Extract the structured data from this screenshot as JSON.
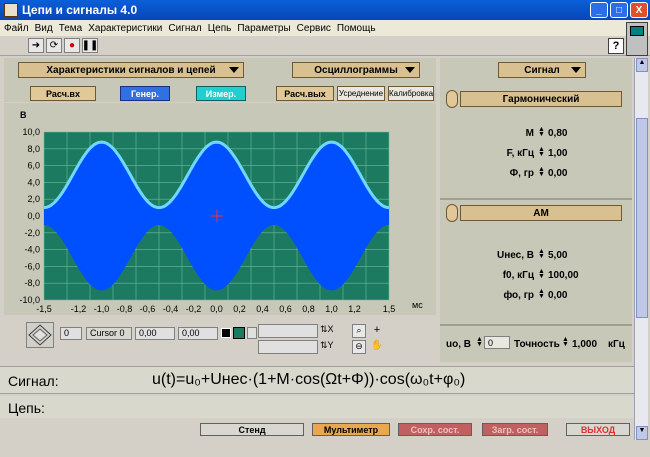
{
  "window": {
    "title": "Цепи и сигналы 4.0",
    "min": "_",
    "max": "□",
    "close": "X"
  },
  "menu": [
    "Файл",
    "Вид",
    "Тема",
    "Характеристики",
    "Сигнал",
    "Цепь",
    "Параметры",
    "Сервис",
    "Помощь"
  ],
  "toolbar": {
    "help": "?"
  },
  "left_dropdown": "Характеристики сигналов и цепей",
  "mid_dropdown": "Осциллограммы",
  "tabs": {
    "calc_in": "Расч.вх",
    "gen": "Генер.",
    "meas": "Измер.",
    "calc_out": "Расч.вых",
    "avg": "Усреднение",
    "calib": "Калибровка"
  },
  "graph": {
    "ylabel": "В",
    "xlabel": "мс",
    "yticks": [
      "10,0",
      "8,0",
      "6,0",
      "4,0",
      "2,0",
      "0,0",
      "-2,0",
      "-4,0",
      "-6,0",
      "-8,0",
      "-10,0"
    ],
    "xticks": [
      "-1,5",
      "-1,2",
      "-1,0",
      "-0,8",
      "-0,6",
      "-0,4",
      "-0,2",
      "0,0",
      "0,2",
      "0,4",
      "0,6",
      "0,8",
      "1,0",
      "1,2",
      "1,5"
    ],
    "colors": {
      "plot_bg": "#1c7a60",
      "grid": "#6fb89e",
      "envelope": "#0050ff",
      "edge": "#70d8ff",
      "cursor": "#ff3030"
    }
  },
  "chart_data": {
    "type": "line",
    "ylabel": "В",
    "xlabel": "мс",
    "xlim": [
      -1.5,
      1.5
    ],
    "ylim": [
      -10,
      10
    ],
    "grid": true,
    "series": [
      {
        "x": [
          -1.5,
          -1.0,
          -0.5,
          0.0,
          0.5,
          1.0,
          1.5
        ],
        "y": [
          1.0,
          8.8,
          1.0,
          8.8,
          1.0,
          8.8,
          1.0
        ]
      },
      {
        "x": [
          -1.5,
          -1.0,
          -0.5,
          0.0,
          0.5,
          1.0,
          1.5
        ],
        "y": [
          -1.0,
          -8.8,
          -1.0,
          -8.8,
          -1.0,
          -8.8,
          -1.0
        ]
      }
    ]
  },
  "cursor": {
    "index": "0",
    "name": "Cursor 0",
    "x": "0,00",
    "y": "0,00"
  },
  "right": {
    "signal_dropdown": "Сигнал",
    "harmonic_label": "Гармонический",
    "M_label": "M",
    "M_value": "0,80",
    "F_label": "F, кГц",
    "F_value": "1,00",
    "Phi_label": "Ф, гр",
    "Phi_value": "0,00",
    "am_label": "АМ",
    "U_label": "Uнес, В",
    "U_value": "5,00",
    "f0_label": "f0, кГц",
    "f0_value": "100,00",
    "phi0_label": "фо, гр",
    "phi0_value": "0,00",
    "u0_label": "uo, В",
    "u0_value": "0",
    "accuracy_label": "Точность",
    "accuracy_value": "1,000",
    "accuracy_unit": "кГц"
  },
  "signal": {
    "label": "Сигнал:",
    "formula": "u(t)=u₀+Uнес·(1+M·cos(Ωt+Φ))·cos(ω₀t+φ₀)"
  },
  "circuit": {
    "label": "Цепь:"
  },
  "bottom": {
    "stand": "Стенд",
    "multimeter": "Мультиметр",
    "save": "Сохр. сост.",
    "load": "Загр. сост.",
    "exit": "ВЫХОД"
  }
}
